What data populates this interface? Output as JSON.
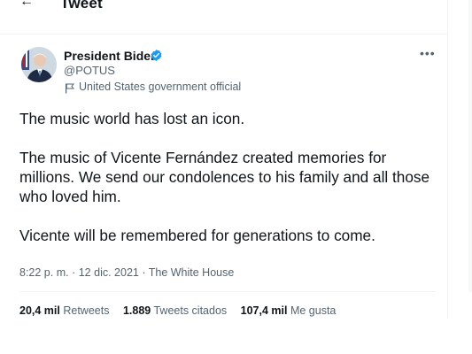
{
  "header": {
    "back_symbol": "←",
    "title": "Tweet"
  },
  "author": {
    "name": "President Biden",
    "handle": "@POTUS",
    "label": "United States government official",
    "verified_color": "#1d9bf0"
  },
  "tweet": {
    "paragraphs": [
      "The music world has lost an icon.",
      "The music of Vicente Fernández created memories for millions. We send our condolences to his family and all those who loved him.",
      "Vicente will be remembered for generations to come."
    ],
    "time": "8:22 p. m.",
    "separator": "·",
    "date": "12 dic. 2021",
    "source": "The White House"
  },
  "stats": {
    "retweets_count": "20,4 mil",
    "retweets_label": "Retweets",
    "quotes_count": "1.889",
    "quotes_label": "Tweets citados",
    "likes_count": "107,4 mil",
    "likes_label": "Me gusta"
  },
  "more_menu_symbol": "•••"
}
